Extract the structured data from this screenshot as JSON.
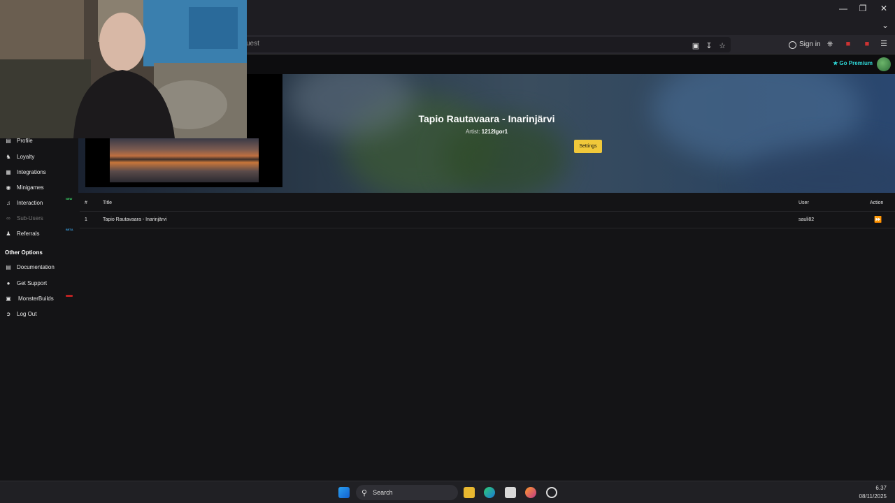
{
  "browser": {
    "url_text": "uest",
    "signin_label": "Sign in"
  },
  "header": {
    "premium_label": "Go Premium"
  },
  "banner": {
    "title": "Tapio Rautavaara - Inarinjärvi",
    "artist_label": "Artist:",
    "artist_name": "1212Igor1",
    "settings_label": "Settings"
  },
  "sidebar": {
    "items": [
      {
        "label": "Profile",
        "icon": "id-card-icon"
      },
      {
        "label": "Loyalty",
        "icon": "trophy-icon"
      },
      {
        "label": "Integrations",
        "icon": "puzzle-icon"
      },
      {
        "label": "Minigames",
        "icon": "gamepad-icon"
      },
      {
        "label": "Interaction",
        "icon": "music-icon",
        "badge": "NEW"
      },
      {
        "label": "Sub-Users",
        "icon": "link-icon"
      },
      {
        "label": "Referrals",
        "icon": "users-icon",
        "badge": "BETA"
      }
    ],
    "other_options_heading": "Other Options",
    "other_items": [
      {
        "label": "Documentation",
        "icon": "book-icon"
      },
      {
        "label": "Get Support",
        "icon": "question-icon"
      },
      {
        "label": "MonsterBuilds",
        "icon": "laptop-icon"
      },
      {
        "label": "Log Out",
        "icon": "logout-icon"
      }
    ]
  },
  "table": {
    "headers": {
      "num": "#",
      "title": "Title",
      "user": "User",
      "action": "Action"
    },
    "rows": [
      {
        "num": "1",
        "title": "Tapio Rautavaara - Inarinjärvi",
        "user": "sauli82"
      }
    ]
  },
  "taskbar": {
    "search_label": "Search",
    "time": "6.37",
    "date": "08/11/2025"
  },
  "colors": {
    "accent_yellow": "#f0c83a",
    "premium_cyan": "#2fd7d7",
    "badge_new": "#3ddc6b",
    "badge_beta": "#3aa0e0"
  }
}
